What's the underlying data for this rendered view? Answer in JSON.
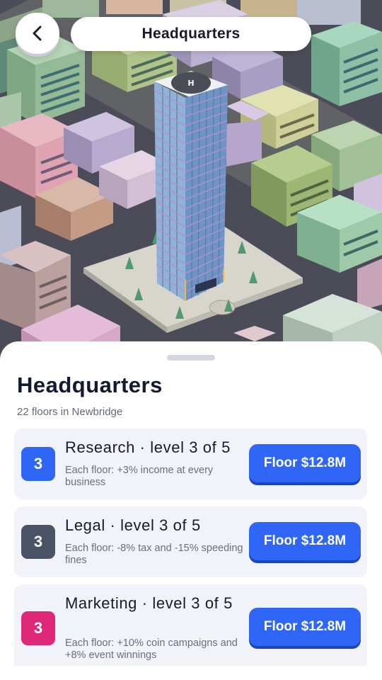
{
  "header": {
    "title": "Headquarters",
    "back_icon": "chevron-left-icon"
  },
  "scene": {
    "description_icon": "city-tower-scene",
    "helipad_letter": "H"
  },
  "sheet": {
    "title": "Headquarters",
    "subtitle": "22 floors in Newbridge",
    "departments": [
      {
        "badge": "3",
        "badge_color": "#2f66f5",
        "title": "Research · level 3 of 5",
        "desc": "Each floor: +3% income at every business",
        "button": "Floor $12.8M",
        "level": 3,
        "max_level": 5
      },
      {
        "badge": "3",
        "badge_color": "#4a5365",
        "title": "Legal · level 3 of 5",
        "desc": "Each floor: -8% tax and -15% speeding fines",
        "button": "Floor $12.8M",
        "level": 3,
        "max_level": 5
      },
      {
        "badge": "3",
        "badge_color": "#e0287a",
        "title": "Marketing · level 3 of 5",
        "desc": "Each floor: +10% coin campaigns and +8% event winnings",
        "button": "Floor $12.8M",
        "level": 3,
        "max_level": 5
      }
    ]
  }
}
